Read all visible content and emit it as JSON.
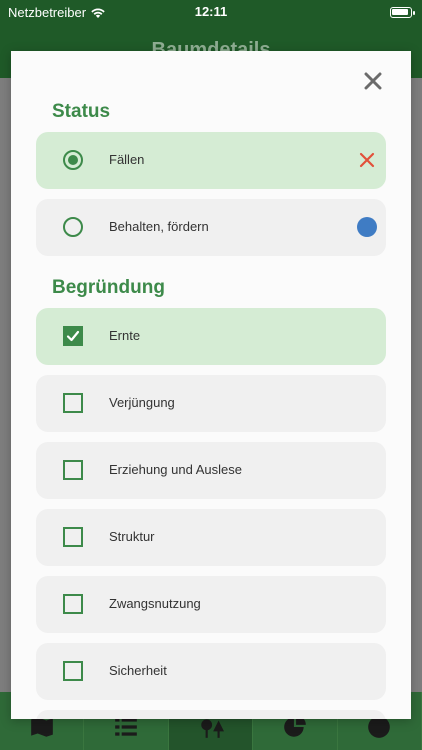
{
  "statusbar": {
    "carrier": "Netzbetreiber",
    "time": "12:11"
  },
  "appbar": {
    "title": "Baumdetails"
  },
  "status": {
    "title": "Status",
    "options": [
      {
        "label": "Fällen",
        "selected": true,
        "trail_icon": "x-icon",
        "trail_color": "#e2513a"
      },
      {
        "label": "Behalten, fördern",
        "selected": false,
        "trail_icon": "blue-dot",
        "trail_color": "#3f7cc4"
      }
    ]
  },
  "begruendung": {
    "title": "Begründung",
    "options": [
      {
        "label": "Ernte",
        "checked": true
      },
      {
        "label": "Verjüngung",
        "checked": false
      },
      {
        "label": "Erziehung und Auslese",
        "checked": false
      },
      {
        "label": "Struktur",
        "checked": false
      },
      {
        "label": "Zwangsnutzung",
        "checked": false
      },
      {
        "label": "Sicherheit",
        "checked": false
      }
    ]
  },
  "tabbar": {
    "tabs": [
      "map-icon",
      "list-icon",
      "tree-icon",
      "pie-chart-icon",
      "info-icon"
    ],
    "active": 2
  },
  "colors": {
    "accent": "#3d8a4a",
    "selected_bg": "#d5ecd4",
    "option_bg": "#f0f0f0",
    "header": "#1f5a28"
  }
}
